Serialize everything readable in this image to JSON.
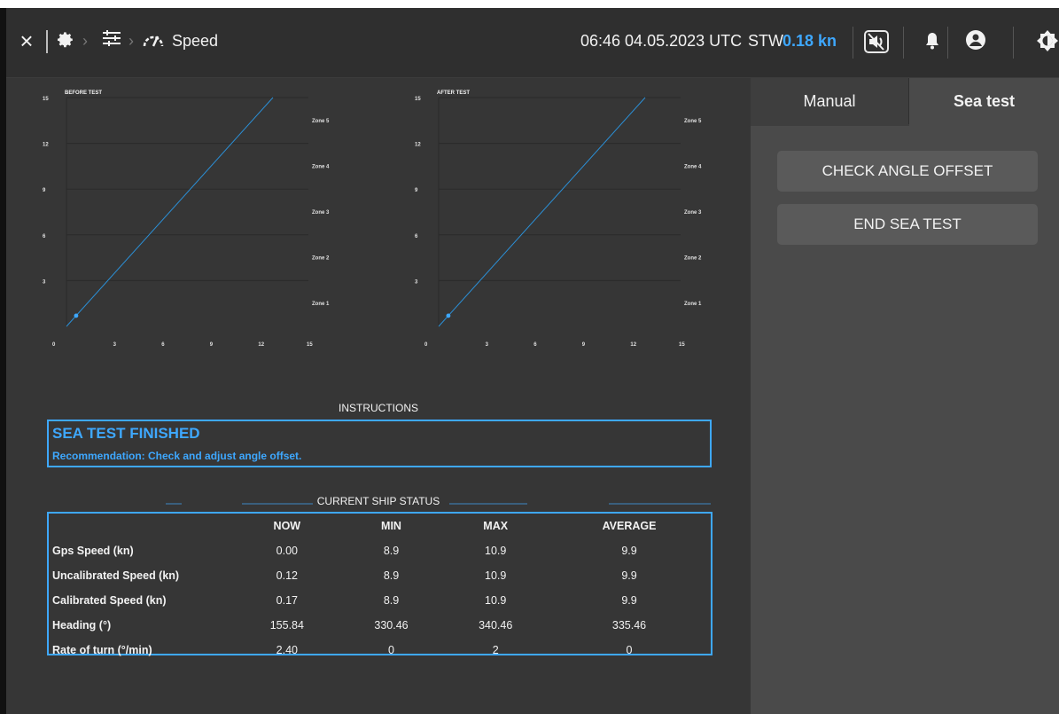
{
  "topbar": {
    "breadcrumb_title": "Speed",
    "datetime": "06:46 04.05.2023 UTC",
    "stw_label": "STW",
    "stw_value": "0.18 kn"
  },
  "charts": [
    {
      "title": "BEFORE TEST",
      "x_ticks": [
        "0",
        "3",
        "6",
        "9",
        "12",
        "15"
      ],
      "y_ticks": [
        "15",
        "12",
        "9",
        "6",
        "3"
      ],
      "zones": [
        "Zone 5",
        "Zone 4",
        "Zone 3",
        "Zone 2",
        "Zone 1"
      ]
    },
    {
      "title": "AFTER TEST",
      "x_ticks": [
        "0",
        "3",
        "6",
        "9",
        "12",
        "15"
      ],
      "y_ticks": [
        "15",
        "12",
        "9",
        "6",
        "3"
      ],
      "zones": [
        "Zone 5",
        "Zone 4",
        "Zone 3",
        "Zone 2",
        "Zone 1"
      ]
    }
  ],
  "chart_data": [
    {
      "type": "line",
      "title": "BEFORE TEST",
      "xlim": [
        0,
        15
      ],
      "ylim": [
        0,
        15
      ],
      "line": {
        "x": [
          0,
          12.8
        ],
        "y": [
          0,
          15
        ]
      },
      "points": [
        {
          "x": 0.6,
          "y": 0.7
        }
      ]
    },
    {
      "type": "line",
      "title": "AFTER TEST",
      "xlim": [
        0,
        15
      ],
      "ylim": [
        0,
        15
      ],
      "line": {
        "x": [
          0,
          12.8
        ],
        "y": [
          0,
          15
        ]
      },
      "points": [
        {
          "x": 0.6,
          "y": 0.7
        }
      ]
    }
  ],
  "instructions": {
    "title": "INSTRUCTIONS",
    "heading": "SEA TEST FINISHED",
    "text": "Recommendation: Check and adjust angle offset."
  },
  "ship_status": {
    "title": "CURRENT SHIP STATUS",
    "columns": [
      "NOW",
      "MIN",
      "MAX",
      "AVERAGE"
    ],
    "rows": [
      {
        "label": "Gps Speed (kn)",
        "values": [
          "0.00",
          "8.9",
          "10.9",
          "9.9"
        ]
      },
      {
        "label": "Uncalibrated Speed (kn)",
        "values": [
          "0.12",
          "8.9",
          "10.9",
          "9.9"
        ]
      },
      {
        "label": "Calibrated Speed (kn)",
        "values": [
          "0.17",
          "8.9",
          "10.9",
          "9.9"
        ]
      },
      {
        "label": "Heading (°)",
        "values": [
          "155.84",
          "330.46",
          "340.46",
          "335.46"
        ]
      },
      {
        "label": "Rate of turn (°/min)",
        "values": [
          "2.40",
          "0",
          "2",
          "0"
        ]
      }
    ]
  },
  "side": {
    "tabs": [
      "Manual",
      "Sea test"
    ],
    "active_tab": "Sea test",
    "buttons": [
      "CHECK ANGLE OFFSET",
      "END SEA TEST"
    ]
  },
  "colors": {
    "accent": "#3ea8ff",
    "background": "#363636",
    "panel": "#4a4a4a"
  }
}
